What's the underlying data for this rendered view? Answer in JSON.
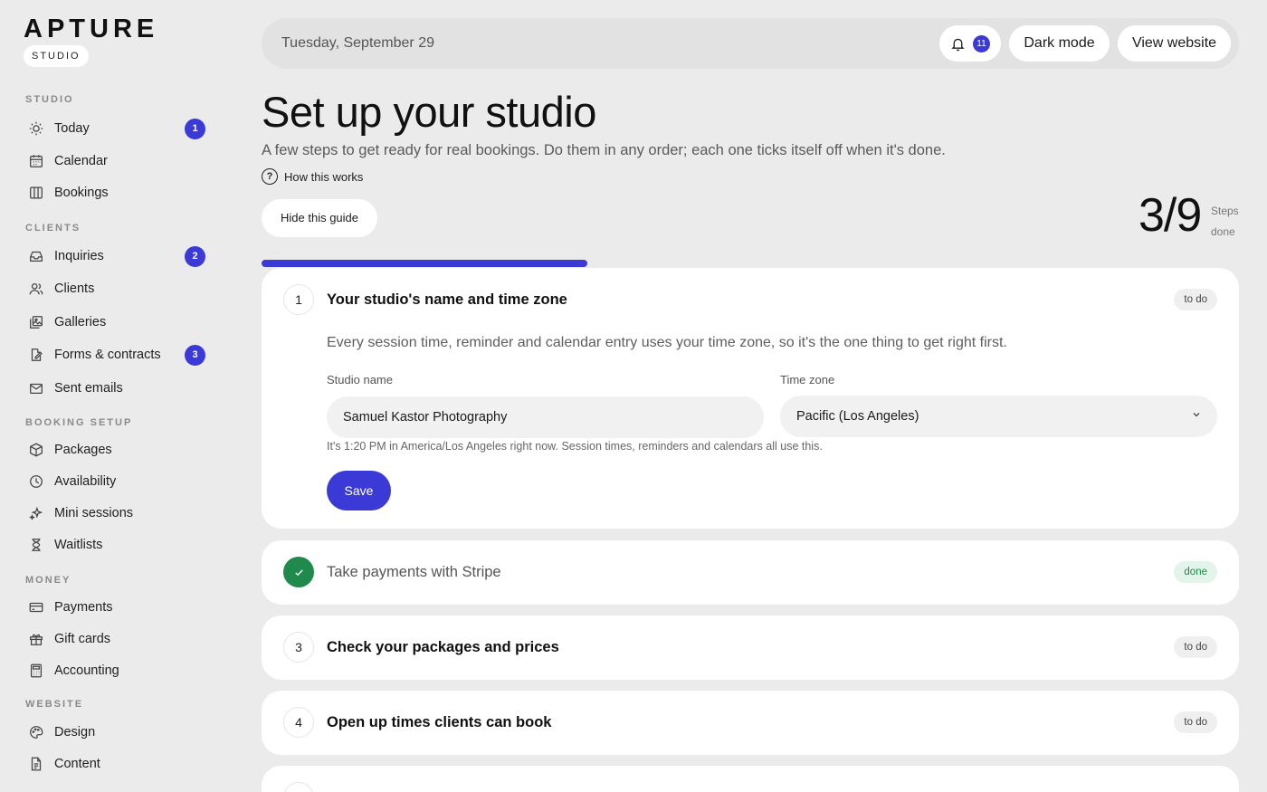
{
  "brand": {
    "logo": "APTURE",
    "badge": "STUDIO"
  },
  "sidebar": {
    "sections": {
      "studio": "STUDIO",
      "clients": "CLIENTS",
      "booking": "BOOKING SETUP",
      "money": "MONEY",
      "website": "WEBSITE"
    },
    "items": {
      "today": {
        "label": "Today",
        "badge": "1",
        "icon": "sun-icon"
      },
      "calendar": {
        "label": "Calendar",
        "icon": "calendar-icon"
      },
      "bookings": {
        "label": "Bookings",
        "icon": "columns-icon"
      },
      "inquiries": {
        "label": "Inquiries",
        "badge": "2",
        "icon": "inbox-icon"
      },
      "clients": {
        "label": "Clients",
        "icon": "users-icon"
      },
      "galleries": {
        "label": "Galleries",
        "icon": "image-icon"
      },
      "forms": {
        "label": "Forms & contracts",
        "badge": "3",
        "icon": "document-pen-icon"
      },
      "sent_emails": {
        "label": "Sent emails",
        "icon": "mail-icon"
      },
      "packages": {
        "label": "Packages",
        "icon": "package-icon"
      },
      "availability": {
        "label": "Availability",
        "icon": "clock-icon"
      },
      "mini_sessions": {
        "label": "Mini sessions",
        "icon": "sparkle-icon"
      },
      "waitlists": {
        "label": "Waitlists",
        "icon": "hourglass-icon"
      },
      "payments": {
        "label": "Payments",
        "icon": "card-icon"
      },
      "gift_cards": {
        "label": "Gift cards",
        "icon": "gift-icon"
      },
      "accounting": {
        "label": "Accounting",
        "icon": "calculator-icon"
      },
      "design": {
        "label": "Design",
        "icon": "palette-icon"
      },
      "content": {
        "label": "Content",
        "icon": "document-icon"
      }
    }
  },
  "header": {
    "date": "Tuesday, September 29",
    "notification_count": "11",
    "dark_mode_label": "Dark mode",
    "view_website_label": "View website"
  },
  "page": {
    "title": "Set up your studio",
    "subtitle": "A few steps to get ready for real bookings. Do them in any order; each one ticks itself off when it's done.",
    "how_it_works": "How this works",
    "hide_guide": "Hide this guide",
    "steps_done": "3/9",
    "steps_label_1": "Steps",
    "steps_label_2": "done",
    "progress_fraction": 0.333
  },
  "steps": [
    {
      "number": "1",
      "title": "Your studio's name and time zone",
      "status": "to do",
      "description": "Every session time, reminder and calendar entry uses your time zone, so it's the one thing to get right first.",
      "studio_name_label": "Studio name",
      "studio_name_value": "Samuel Kastor Photography",
      "time_zone_label": "Time zone",
      "time_zone_value": "Pacific (Los Angeles)",
      "helper": "It's 1:20 PM in America/Los Angeles right now. Session times, reminders and calendars all use this.",
      "save_label": "Save"
    },
    {
      "number": "2",
      "title": "Take payments with Stripe",
      "status": "done"
    },
    {
      "number": "3",
      "title": "Check your packages and prices",
      "status": "to do"
    },
    {
      "number": "4",
      "title": "Open up times clients can book",
      "status": "to do"
    }
  ],
  "colors": {
    "accent": "#3b3ad6",
    "success": "#1f8a4c",
    "background": "#ebebeb"
  }
}
